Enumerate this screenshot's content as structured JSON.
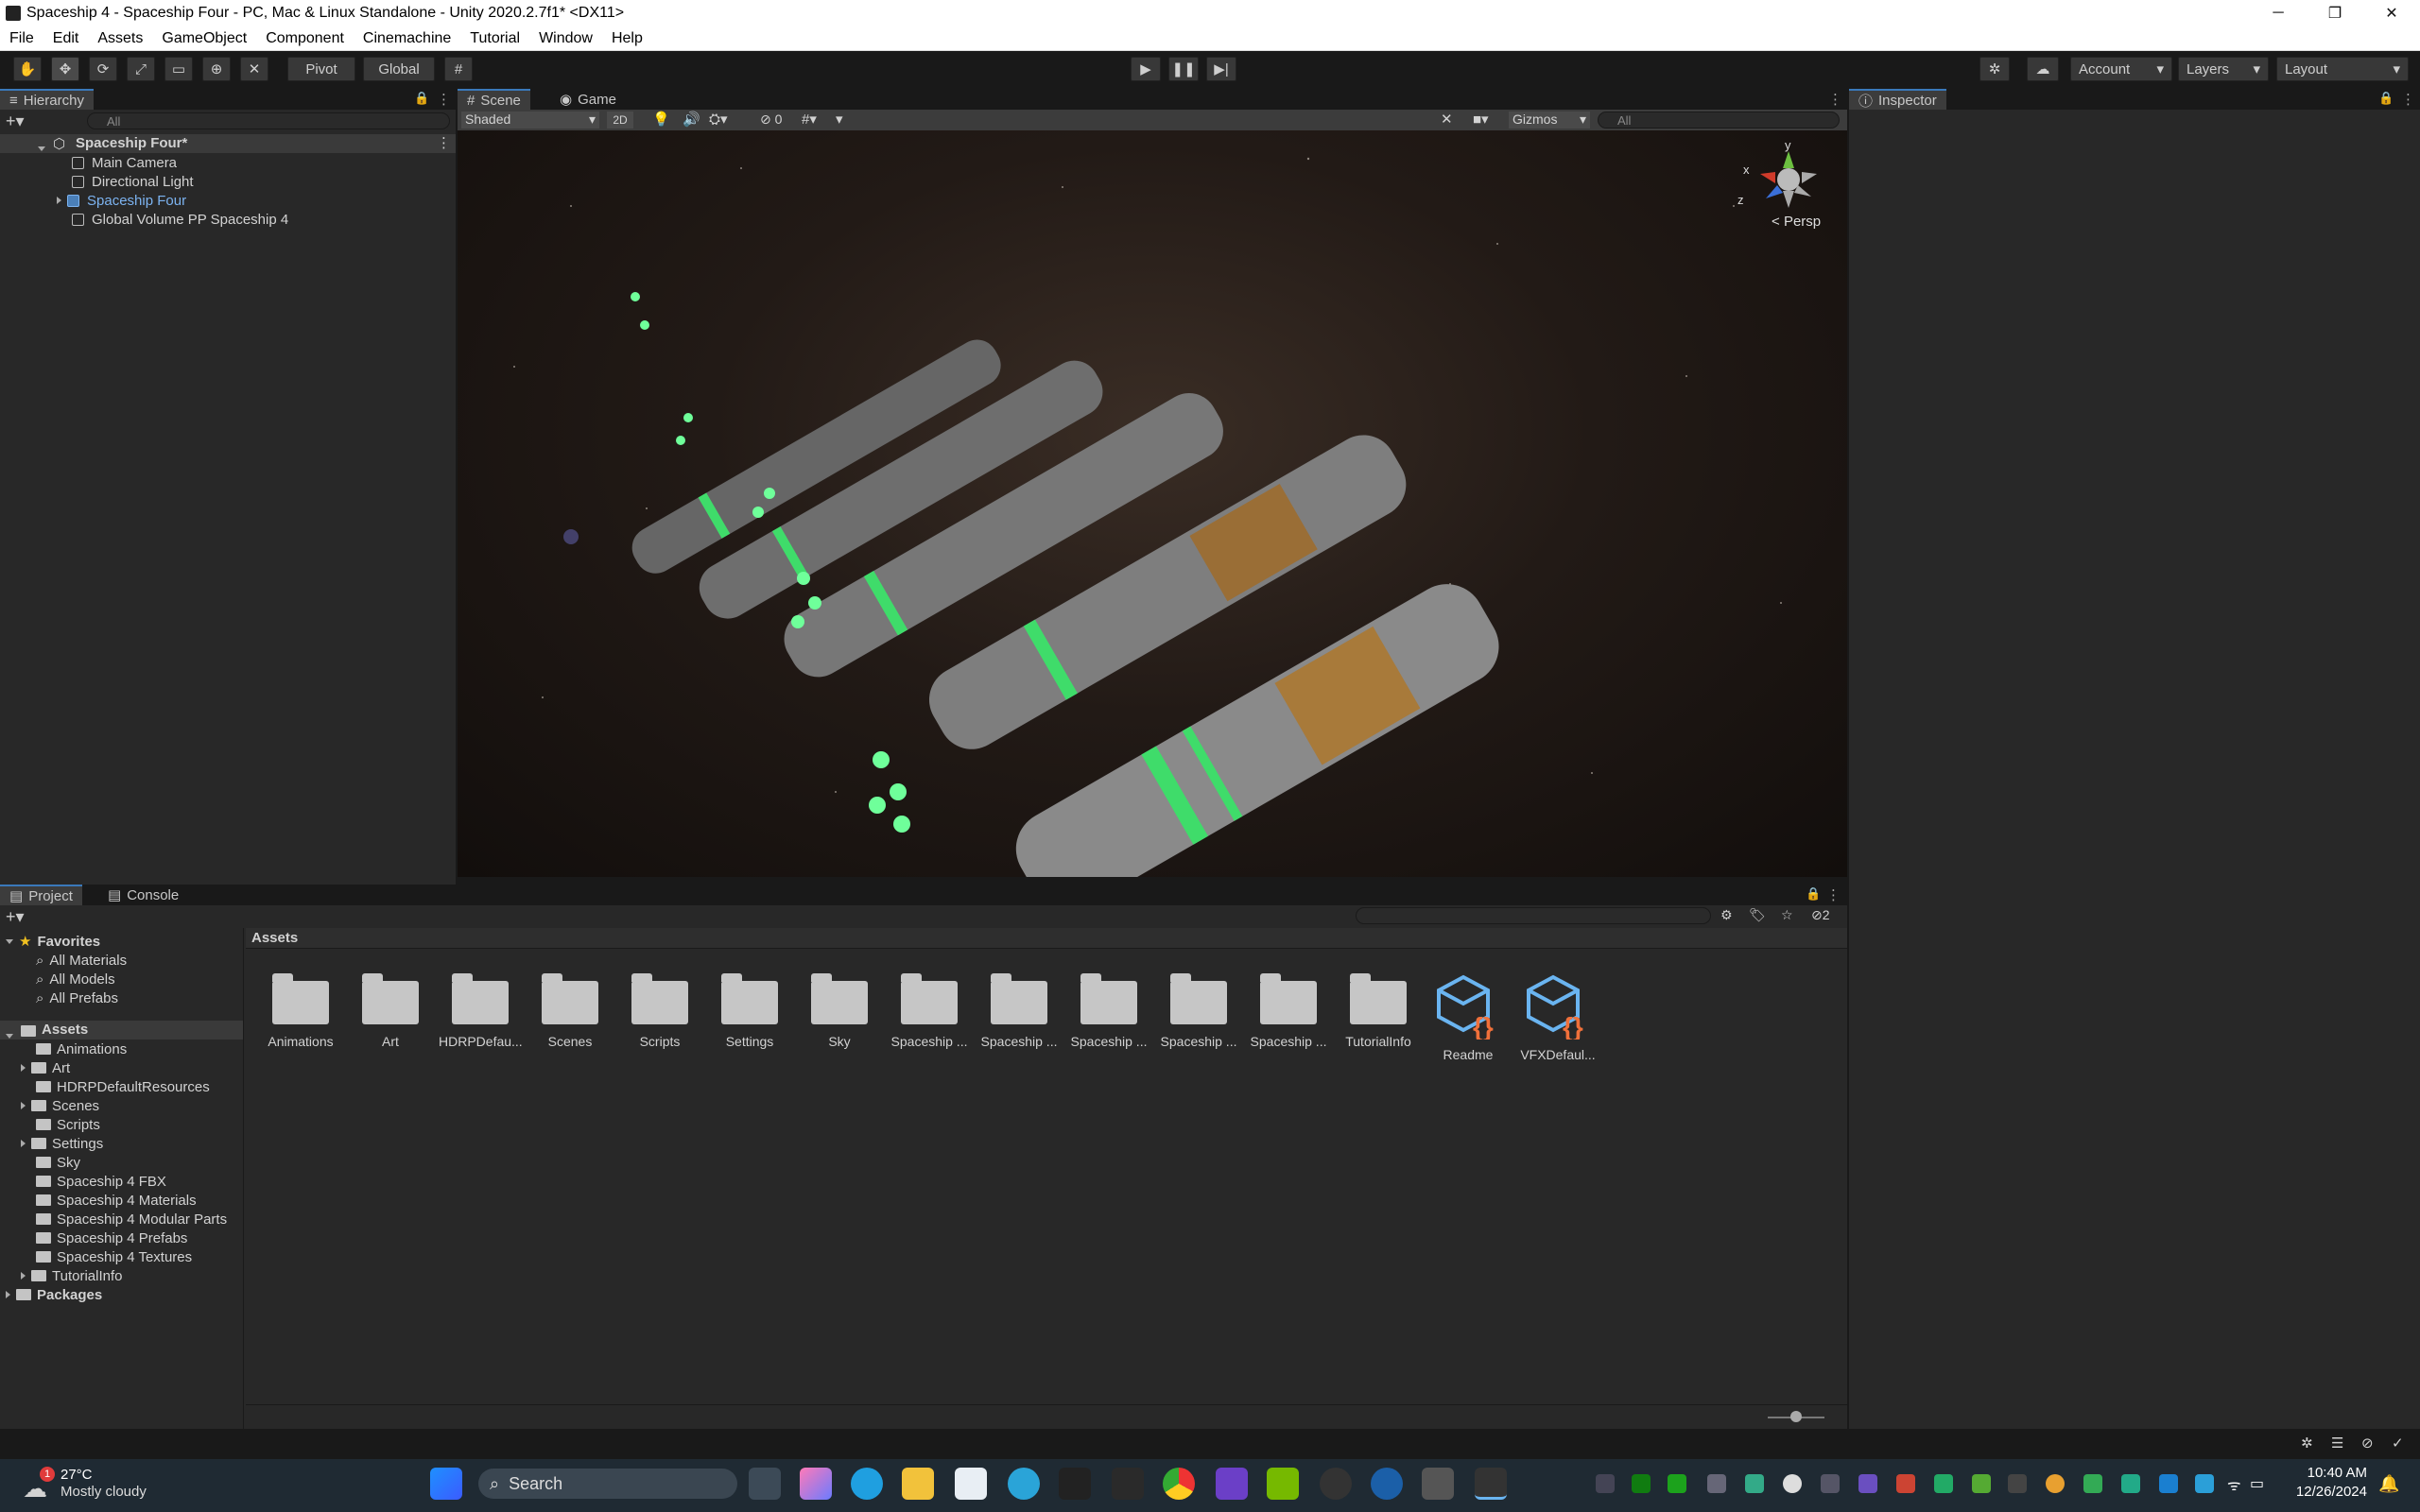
{
  "window": {
    "title": "Spaceship 4 - Spaceship Four - PC, Mac & Linux Standalone - Unity 2020.2.7f1* <DX11>",
    "controls": [
      "─",
      "❐",
      "✕"
    ]
  },
  "menu": [
    "File",
    "Edit",
    "Assets",
    "GameObject",
    "Component",
    "Cinemachine",
    "Tutorial",
    "Window",
    "Help"
  ],
  "toolbar": {
    "pivot_label": "Pivot",
    "global_label": "Global",
    "account_label": "Account",
    "layers_label": "Layers",
    "layout_label": "Layout"
  },
  "hierarchy": {
    "tab_label": "Hierarchy",
    "search_placeholder": "All",
    "scene_name": "Spaceship Four*",
    "items": [
      {
        "label": "Main Camera"
      },
      {
        "label": "Directional Light"
      },
      {
        "label": "Spaceship Four"
      },
      {
        "label": "Global Volume PP Spaceship 4"
      }
    ]
  },
  "scene": {
    "tab_scene": "Scene",
    "tab_game": "Game",
    "shading_mode": "Shaded",
    "mode_2d": "2D",
    "hidden_count": "0",
    "gizmos_label": "Gizmos",
    "search_placeholder": "All",
    "view_label": "Persp",
    "axis_x": "x",
    "axis_y": "y",
    "axis_z": "z"
  },
  "inspector": {
    "tab_label": "Inspector"
  },
  "project": {
    "tab_project": "Project",
    "tab_console": "Console",
    "favorites_label": "Favorites",
    "favorites": [
      "All Materials",
      "All Models",
      "All Prefabs"
    ],
    "assets_label": "Assets",
    "asset_tree": [
      "Animations",
      "Art",
      "HDRPDefaultResources",
      "Scenes",
      "Scripts",
      "Settings",
      "Sky",
      "Spaceship 4 FBX",
      "Spaceship 4 Materials",
      "Spaceship 4 Modular Parts",
      "Spaceship 4 Prefabs",
      "Spaceship 4 Textures",
      "TutorialInfo"
    ],
    "packages_label": "Packages",
    "breadcrumb": "Assets",
    "hidden_packages_count": "2",
    "grid_items": [
      "Animations",
      "Art",
      "HDRPDefau...",
      "Scenes",
      "Scripts",
      "Settings",
      "Sky",
      "Spaceship ...",
      "Spaceship ...",
      "Spaceship ...",
      "Spaceship ...",
      "Spaceship ...",
      "TutorialInfo",
      "Readme",
      "VFXDefaul..."
    ]
  },
  "taskbar": {
    "weather_temp": "27°C",
    "weather_desc": "Mostly cloudy",
    "weather_badge": "1",
    "search_label": "Search",
    "time": "10:40 AM",
    "date": "12/26/2024"
  },
  "colors": {
    "editor_bg": "#191919",
    "panel_bg": "#282828",
    "accent_blue": "#7cb3f0",
    "json_orange": "#f0703a"
  }
}
